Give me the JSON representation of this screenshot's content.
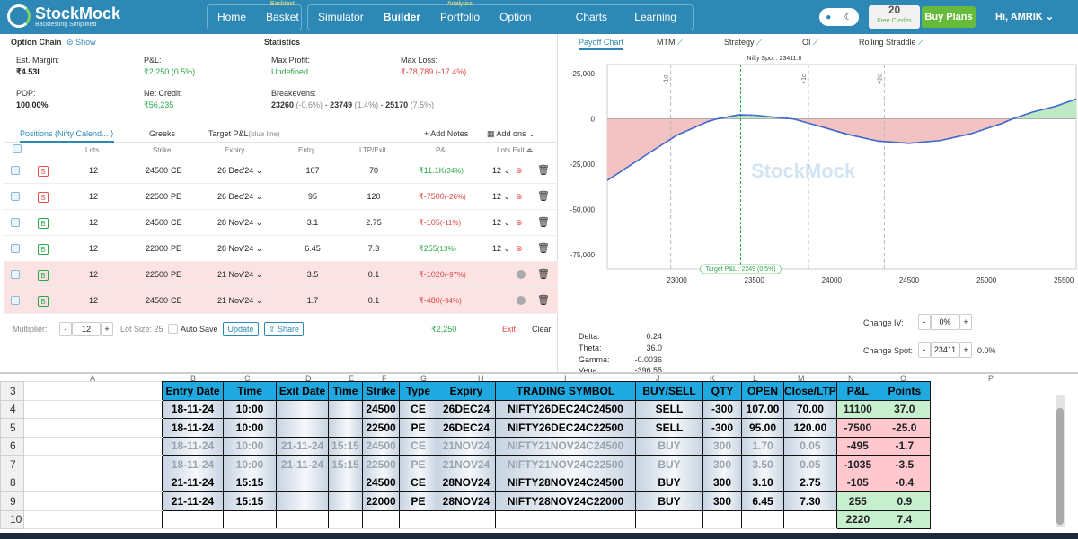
{
  "nav": {
    "brand": "StockMock",
    "tagline": "Backtesting Simplified",
    "group1": [
      {
        "label": "Home",
        "sup": ""
      },
      {
        "label": "Basket",
        "sup": "Backtest"
      }
    ],
    "group2": [
      {
        "label": "Simulator",
        "sup": ""
      },
      {
        "label": "Builder",
        "sup": ""
      },
      {
        "label": "Portfolio",
        "sup": "Analytics"
      },
      {
        "label": "Option Chain",
        "sup": ""
      },
      {
        "label": "Charts",
        "sup": ""
      },
      {
        "label": "Learning",
        "sup": ""
      }
    ],
    "credits_value": "20",
    "credits_label": "Free Credits",
    "buy_label": "Buy Plans",
    "user": "Hi, AMRIK"
  },
  "summary": {
    "option_chain": "Option Chain",
    "show": "Show",
    "statistics": "Statistics",
    "est_margin_label": "Est. Margin:",
    "est_margin": "₹4.53L",
    "pnl_label": "P&L:",
    "pnl": "₹2,250",
    "pnl_pct": "(0.5%)",
    "max_profit_label": "Max Profit:",
    "max_profit": "Undefined",
    "max_loss_label": "Max Loss:",
    "max_loss": "₹-78,789",
    "max_loss_pct": "(-17.4%)",
    "pop_label": "POP:",
    "pop": "100.00%",
    "net_credit_label": "Net Credit:",
    "net_credit": "₹56,235",
    "breakevens_label": "Breakevens:",
    "be1": "23260",
    "be1_pct": "(-0.6%)",
    "be2": "23749",
    "be2_pct": "(1.4%)",
    "be3": "25170",
    "be3_pct": "(7.5%)"
  },
  "tabs": {
    "positions": "Positions (Nifty Calend...",
    "greeks": "Greeks",
    "target": "Target P&L",
    "target_sub": "(blue line)",
    "add_notes": "Add Notes",
    "add_ons": "Add ons"
  },
  "headers": {
    "lots": "Lots",
    "strike": "Strike",
    "expiry": "Expiry",
    "entry": "Entry",
    "ltp": "LTP/Exit",
    "pnl": "P&L",
    "lots_exit": "Lots Exit"
  },
  "positions": [
    {
      "side": "S",
      "lots": "12",
      "strike": "24500",
      "type": "CE",
      "expiry": "26 Dec'24",
      "entry": "107",
      "ltp": "70",
      "pnl": "₹11.1K",
      "pct": "(34%)",
      "sign": "pos",
      "exitlots": "12",
      "open": true
    },
    {
      "side": "S",
      "lots": "12",
      "strike": "22500",
      "type": "PE",
      "expiry": "26 Dec'24",
      "entry": "95",
      "ltp": "120",
      "pnl": "₹-7500",
      "pct": "(-26%)",
      "sign": "neg",
      "exitlots": "12",
      "open": true
    },
    {
      "side": "B",
      "lots": "12",
      "strike": "24500",
      "type": "CE",
      "expiry": "28 Nov'24",
      "entry": "3.1",
      "ltp": "2.75",
      "pnl": "₹-105",
      "pct": "(-11%)",
      "sign": "neg",
      "exitlots": "12",
      "open": true
    },
    {
      "side": "B",
      "lots": "12",
      "strike": "22000",
      "type": "PE",
      "expiry": "28 Nov'24",
      "entry": "6.45",
      "ltp": "7.3",
      "pnl": "₹255",
      "pct": "(13%)",
      "sign": "pos",
      "exitlots": "12",
      "open": true
    },
    {
      "side": "B",
      "lots": "12",
      "strike": "22500",
      "type": "PE",
      "expiry": "21 Nov'24",
      "entry": "3.5",
      "ltp": "0.1",
      "pnl": "₹-1020",
      "pct": "(-97%)",
      "sign": "neg",
      "exitlots": "",
      "open": false
    },
    {
      "side": "B",
      "lots": "12",
      "strike": "24500",
      "type": "CE",
      "expiry": "21 Nov'24",
      "entry": "1.7",
      "ltp": "0.1",
      "pnl": "₹-480",
      "pct": "(-94%)",
      "sign": "neg",
      "exitlots": "",
      "open": false
    }
  ],
  "footer": {
    "multiplier_label": "Multiplier:",
    "multiplier": "12",
    "lot_size": "Lot Size: 25",
    "autosave": "Auto Save",
    "update": "Update",
    "share": "Share",
    "total": "₹2,250",
    "exit": "Exit",
    "clear": "Clear"
  },
  "chart_tabs": [
    "Payoff Chart",
    "MTM",
    "Strategy",
    "OI",
    "Rolling Straddle"
  ],
  "chart_data": {
    "type": "line",
    "title": "Nifty Spot : 23411.8",
    "xlim": [
      22550,
      25580
    ],
    "ylim": [
      -83000,
      30000
    ],
    "x_ticks": [
      23000,
      23500,
      24000,
      24500,
      25000,
      25500
    ],
    "y_ticks": [
      25000,
      0,
      -25000,
      -50000,
      -75000
    ],
    "y_tick_labels": [
      "25,000",
      "0",
      "-25,000",
      "-50,000",
      "-75,000"
    ],
    "sd_lines": [
      {
        "x": 22960,
        "label": "-1σ"
      },
      {
        "x": 23850,
        "label": "+1σ"
      },
      {
        "x": 24340,
        "label": "+2σ"
      }
    ],
    "spot": 23411.8,
    "target_label": "Target P&L : 2249 (0.5%)",
    "series": [
      {
        "x": [
          22550,
          22800,
          23000,
          23200,
          23260,
          23400,
          23500,
          23600,
          23749,
          23900,
          24100,
          24300,
          24500,
          24700,
          24900,
          25100,
          25170,
          25300,
          25450,
          25580
        ],
        "y": [
          -34000,
          -20000,
          -9000,
          -1500,
          0,
          2200,
          2000,
          1200,
          0,
          -3500,
          -8500,
          -12300,
          -13500,
          -12000,
          -8200,
          -2500,
          0,
          3800,
          7000,
          11000
        ]
      }
    ]
  },
  "greeks": {
    "delta_label": "Delta:",
    "delta": "0.24",
    "theta_label": "Theta:",
    "theta": "36.0",
    "gamma_label": "Gamma:",
    "gamma": "-0.0036",
    "vega_label": "Vega:",
    "vega": "-396.55",
    "change_iv_label": "Change IV:",
    "change_iv": "0%",
    "change_spot_label": "Change Spot:",
    "change_spot": "23411",
    "change_spot_pct": "0.0%"
  },
  "sheet": {
    "col_letters": [
      "A",
      "B",
      "C",
      "D",
      "E",
      "F",
      "G",
      "H",
      "I",
      "J",
      "K",
      "L",
      "M",
      "N",
      "O",
      "P"
    ],
    "headers": [
      "Entry Date",
      "Time",
      "Exit Date",
      "Time",
      "Strike",
      "Type",
      "Expiry",
      "TRADING SYMBOL",
      "BUY/SELL",
      "QTY",
      "OPEN",
      "Close/LTP",
      "P&L",
      "Points"
    ],
    "rows": [
      {
        "n": "4",
        "cells": [
          "18-11-24",
          "10:00",
          "",
          "",
          "24500",
          "CE",
          "26DEC24",
          "NIFTY26DEC24C24500",
          "SELL",
          "-300",
          "107.00",
          "70.00"
        ],
        "pnl": "11100",
        "pts": "37.0",
        "sign": "pos",
        "fade": false
      },
      {
        "n": "5",
        "cells": [
          "18-11-24",
          "10:00",
          "",
          "",
          "22500",
          "PE",
          "26DEC24",
          "NIFTY26DEC24C22500",
          "SELL",
          "-300",
          "95.00",
          "120.00"
        ],
        "pnl": "-7500",
        "pts": "-25.0",
        "sign": "neg",
        "fade": false
      },
      {
        "n": "6",
        "cells": [
          "18-11-24",
          "10:00",
          "21-11-24",
          "15:15",
          "24500",
          "CE",
          "21NOV24",
          "NIFTY21NOV24C24500",
          "BUY",
          "300",
          "1.70",
          "0.05"
        ],
        "pnl": "-495",
        "pts": "-1.7",
        "sign": "neg",
        "fade": true
      },
      {
        "n": "7",
        "cells": [
          "18-11-24",
          "10:00",
          "21-11-24",
          "15:15",
          "22500",
          "PE",
          "21NOV24",
          "NIFTY21NOV24C22500",
          "BUY",
          "300",
          "3.50",
          "0.05"
        ],
        "pnl": "-1035",
        "pts": "-3.5",
        "sign": "neg",
        "fade": true
      },
      {
        "n": "8",
        "cells": [
          "21-11-24",
          "15:15",
          "",
          "",
          "24500",
          "CE",
          "28NOV24",
          "NIFTY28NOV24C24500",
          "BUY",
          "300",
          "3.10",
          "2.75"
        ],
        "pnl": "-105",
        "pts": "-0.4",
        "sign": "neg",
        "fade": false
      },
      {
        "n": "9",
        "cells": [
          "21-11-24",
          "15:15",
          "",
          "",
          "22000",
          "PE",
          "28NOV24",
          "NIFTY28NOV24C22000",
          "BUY",
          "300",
          "6.45",
          "7.30"
        ],
        "pnl": "255",
        "pts": "0.9",
        "sign": "pos",
        "fade": false
      }
    ],
    "total_row": "10",
    "total_pnl": "2220",
    "total_pts": "7.4",
    "header_row": "3"
  }
}
